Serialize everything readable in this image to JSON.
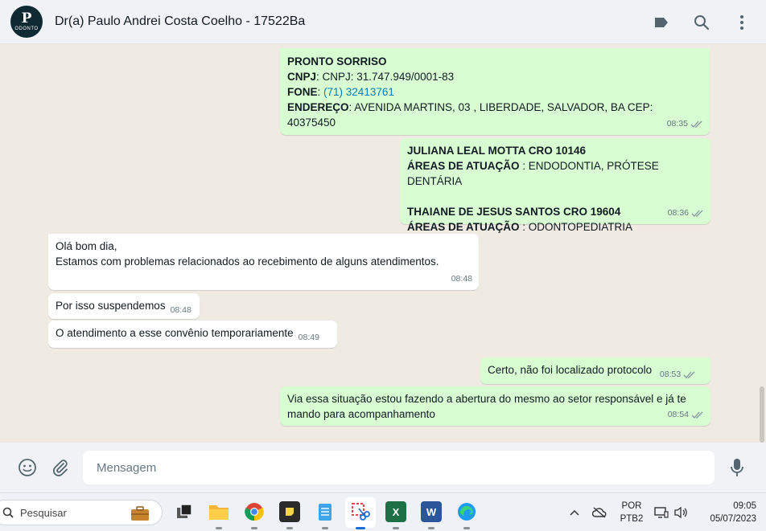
{
  "header": {
    "avatar_mark": "P",
    "avatar_word": "ODONTO",
    "contact_name": "Dr(a) Paulo Andrei Costa Coelho - 17522Ba"
  },
  "messages": [
    {
      "label_name": "PRONTO SORRISO",
      "cnpj_label": "CNPJ",
      "cnpj_value": ": CNPJ: 31.747.949/0001-83",
      "fone_label": "FONE",
      "fone_sep": ": ",
      "fone_value": "(71) 32413761",
      "endereco_label": "ENDEREÇO",
      "endereco_value": ": AVENIDA MARTINS, 03 , LIBERDADE, SALVADOR, BA CEP: 40375450",
      "time": "08:35"
    },
    {
      "line1_bold": "JULIANA LEAL MOTTA CRO 10146",
      "line2_label": "ÁREAS DE ATUAÇÃO",
      "line2_value": " : ENDODONTIA, PRÓTESE DENTÁRIA",
      "line3_bold": "THAIANE DE JESUS SANTOS CRO 19604",
      "line4_label": "ÁREAS DE ATUAÇÃO",
      "line4_value": " : ODONTOPEDIATRIA",
      "time": "08:36"
    },
    {
      "line1": "Olá bom dia,",
      "line2": "Estamos com problemas relacionados ao recebimento de alguns atendimentos.",
      "time": "08:48"
    },
    {
      "text": "Por isso suspendemos",
      "time": "08:48"
    },
    {
      "text": "O atendimento a esse convênio temporariamente",
      "time": "08:49"
    },
    {
      "text": "Certo, não foi localizado protocolo",
      "time": "08:53"
    },
    {
      "line1": "Via essa situação estou fazendo a abertura do mesmo ao setor responsável e já te",
      "line2": "mando para acompanhamento",
      "time": "08:54"
    }
  ],
  "composer": {
    "placeholder": "Mensagem"
  },
  "taskbar": {
    "search_label": "Pesquisar",
    "lang_line1": "POR",
    "lang_line2": "PTB2",
    "clock_time": "09:05",
    "clock_date": "05/07/2023"
  },
  "colors": {
    "outgoing": "#d9fdd3",
    "incoming": "#ffffff",
    "link": "#027eb5"
  }
}
